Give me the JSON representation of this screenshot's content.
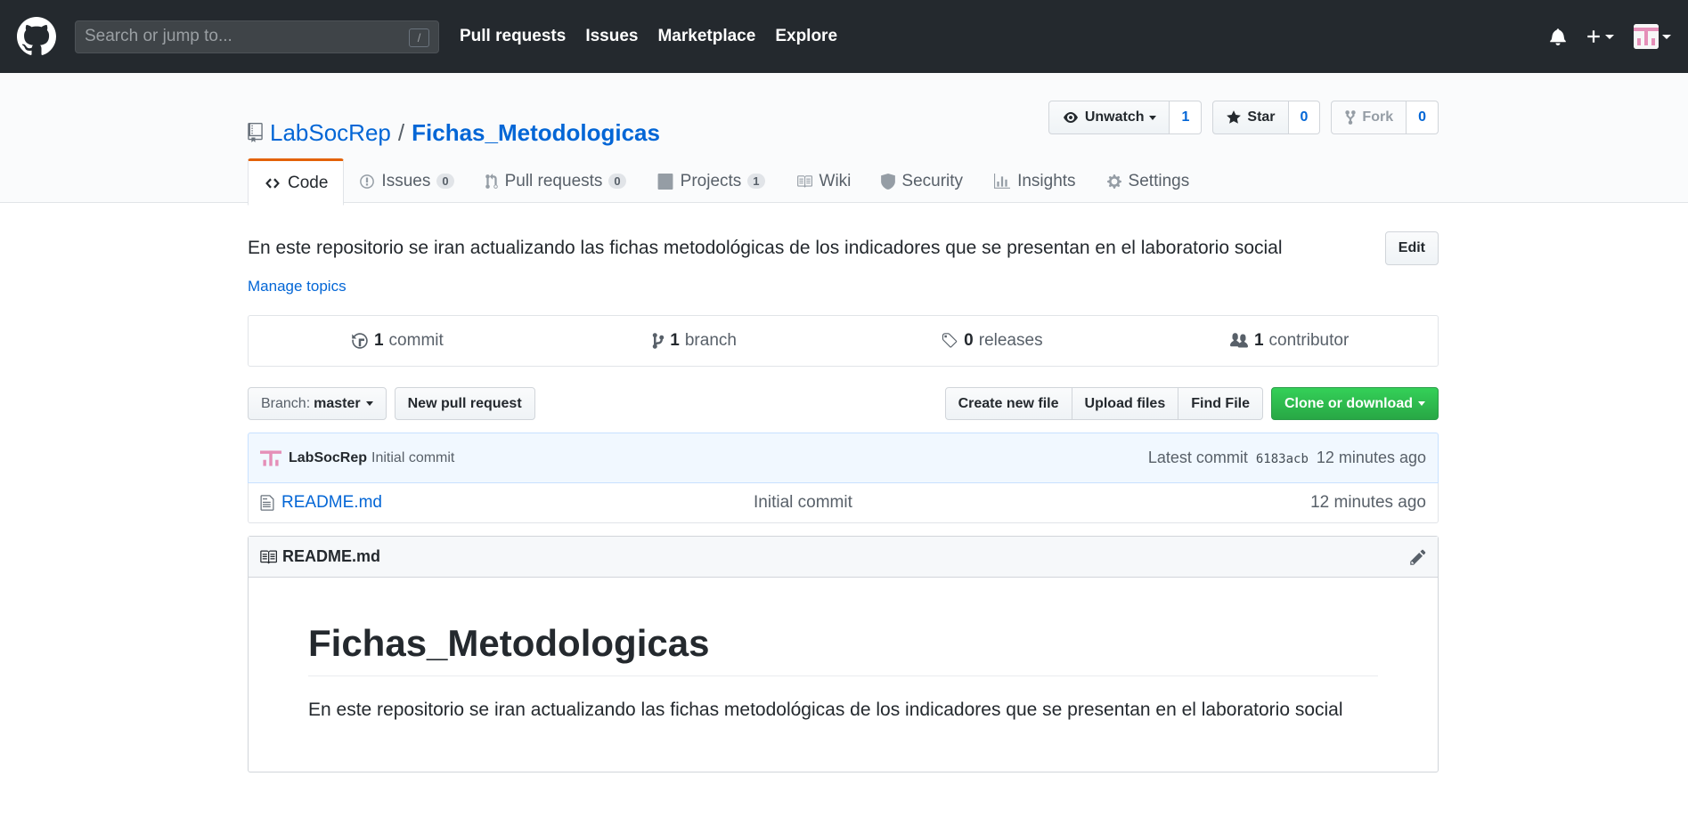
{
  "header": {
    "search_placeholder": "Search or jump to...",
    "search_shortcut": "/",
    "nav": [
      "Pull requests",
      "Issues",
      "Marketplace",
      "Explore"
    ]
  },
  "repo": {
    "owner": "LabSocRep",
    "separator": "/",
    "name": "Fichas_Metodologicas",
    "watch_label": "Unwatch",
    "watch_count": "1",
    "star_label": "Star",
    "star_count": "0",
    "fork_label": "Fork",
    "fork_count": "0"
  },
  "tabs": [
    {
      "label": "Code",
      "icon": "code-icon"
    },
    {
      "label": "Issues",
      "count": "0",
      "icon": "issue-icon"
    },
    {
      "label": "Pull requests",
      "count": "0",
      "icon": "pull-request-icon"
    },
    {
      "label": "Projects",
      "count": "1",
      "icon": "project-icon"
    },
    {
      "label": "Wiki",
      "icon": "book-icon"
    },
    {
      "label": "Security",
      "icon": "shield-icon"
    },
    {
      "label": "Insights",
      "icon": "graph-icon"
    },
    {
      "label": "Settings",
      "icon": "gear-icon"
    }
  ],
  "description": "En este repositorio se iran actualizando las fichas metodológicas de los indicadores que se presentan en el laboratorio social",
  "edit_label": "Edit",
  "manage_topics": "Manage topics",
  "numbers": {
    "commits_count": "1",
    "commits_label": "commit",
    "branches_count": "1",
    "branches_label": "branch",
    "releases_count": "0",
    "releases_label": "releases",
    "contributors_count": "1",
    "contributors_label": "contributor"
  },
  "file_nav": {
    "branch_prefix": "Branch:",
    "branch_name": "master",
    "new_pr": "New pull request",
    "create_file": "Create new file",
    "upload_files": "Upload files",
    "find_file": "Find File",
    "clone": "Clone or download"
  },
  "commit": {
    "author": "LabSocRep",
    "message": "Initial commit",
    "latest_prefix": "Latest commit",
    "sha": "6183acb",
    "age": "12 minutes ago"
  },
  "files": [
    {
      "name": "README.md",
      "message": "Initial commit",
      "age": "12 minutes ago"
    }
  ],
  "readme": {
    "filename": "README.md",
    "heading": "Fichas_Metodologicas",
    "body": "En este repositorio se iran actualizando las fichas metodológicas de los indicadores que se presentan en el laboratorio social"
  },
  "colors": {
    "header_bg": "#24292e",
    "link": "#0366d6",
    "tab_accent": "#e36209",
    "primary_button": "#28a745"
  }
}
